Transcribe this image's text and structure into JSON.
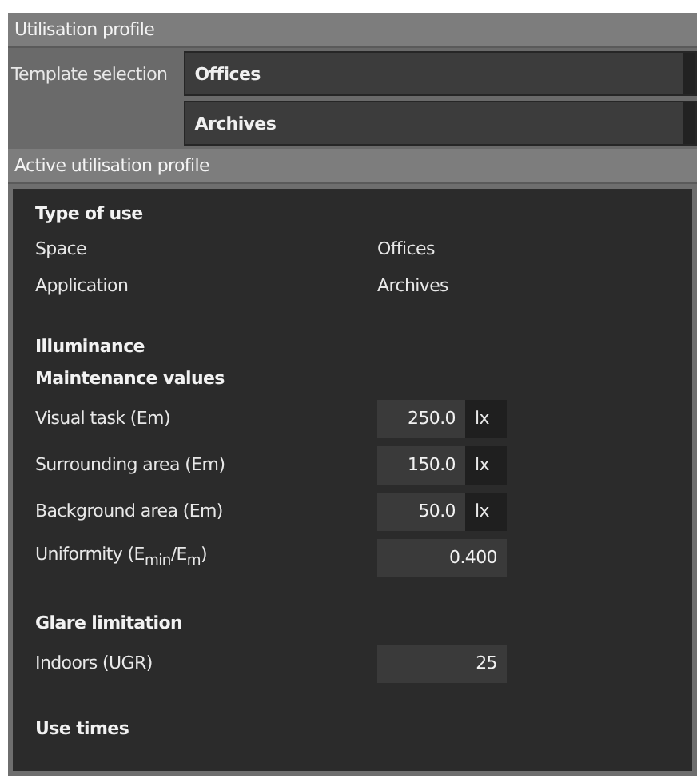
{
  "header": {
    "title": "Utilisation profile"
  },
  "template_selection": {
    "label": "Template selection",
    "dropdowns": [
      {
        "value": "Offices"
      },
      {
        "value": "Archives"
      }
    ]
  },
  "active_profile": {
    "title": "Active utilisation profile",
    "groups": [
      {
        "heading": "Type of use",
        "rows": [
          {
            "kind": "text",
            "label": "Space",
            "value": "Offices"
          },
          {
            "kind": "text",
            "label": "Application",
            "value": "Archives"
          }
        ]
      },
      {
        "heading": "Illuminance",
        "subheading": "Maintenance values",
        "rows": [
          {
            "kind": "field",
            "label": "Visual task (Em)",
            "value": "250.0",
            "unit": "lx"
          },
          {
            "kind": "field",
            "label": "Surrounding area (Em)",
            "value": "150.0",
            "unit": "lx"
          },
          {
            "kind": "field",
            "label": "Background area (Em)",
            "value": "50.0",
            "unit": "lx"
          },
          {
            "kind": "field",
            "label": "Uniformity (E$_{min}$/E$_{m}$)",
            "value": "0.400"
          }
        ]
      },
      {
        "heading": "Glare limitation",
        "rows": [
          {
            "kind": "field",
            "label": "Indoors (UGR)",
            "value": "25"
          }
        ]
      },
      {
        "heading": "Use times"
      }
    ]
  }
}
